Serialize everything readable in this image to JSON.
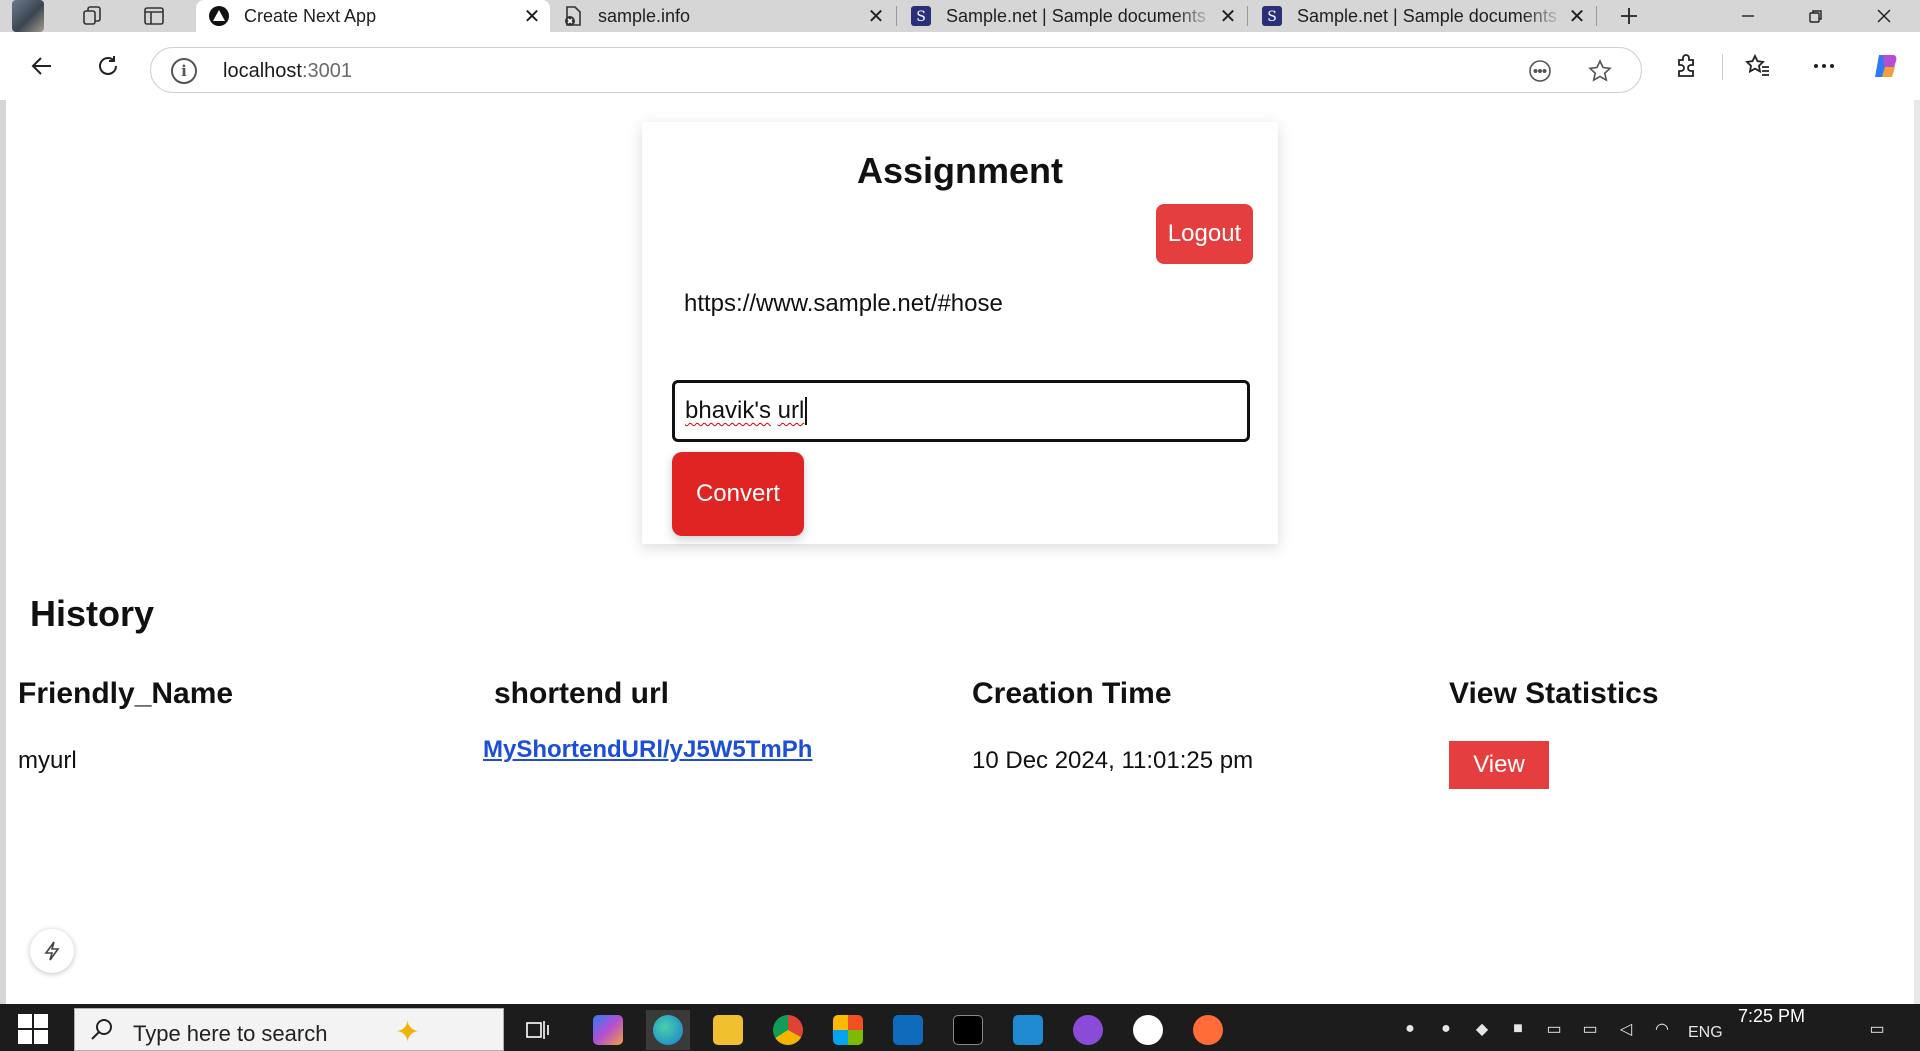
{
  "browser": {
    "tabs": [
      {
        "title": "Create Next App",
        "active": true,
        "icon": "nextjs-triangle-icon"
      },
      {
        "title": "sample.info",
        "active": false,
        "icon": "error-document-icon"
      },
      {
        "title": "Sample.net | Sample documents",
        "active": false,
        "icon": "s-logo-icon"
      },
      {
        "title": "Sample.net | Sample documents",
        "active": false,
        "icon": "s-logo-icon"
      }
    ],
    "url_host": "localhost",
    "url_port": ":3001"
  },
  "card": {
    "title": "Assignment",
    "logout_label": "Logout",
    "long_url": "https://www.sample.net/#hose",
    "name_input_value_word1": "bhavik's",
    "name_input_value_word2": "url",
    "convert_label": "Convert"
  },
  "history": {
    "title": "History",
    "columns": [
      "Friendly_Name",
      "shortend url",
      "Creation Time",
      "View Statistics"
    ],
    "rows": [
      {
        "friendly_name": "myurl",
        "short_url": "MyShortendURl/yJ5W5TmPh",
        "created": "10 Dec 2024, 11:01:25 pm",
        "view_label": "View"
      }
    ]
  },
  "taskbar": {
    "search_placeholder": "Type here to search",
    "lang": "ENG",
    "time": "7:25 PM"
  },
  "colors": {
    "accent_red": "#e53e3e",
    "convert_red": "#e02424",
    "link_blue": "#1d4ed8"
  }
}
